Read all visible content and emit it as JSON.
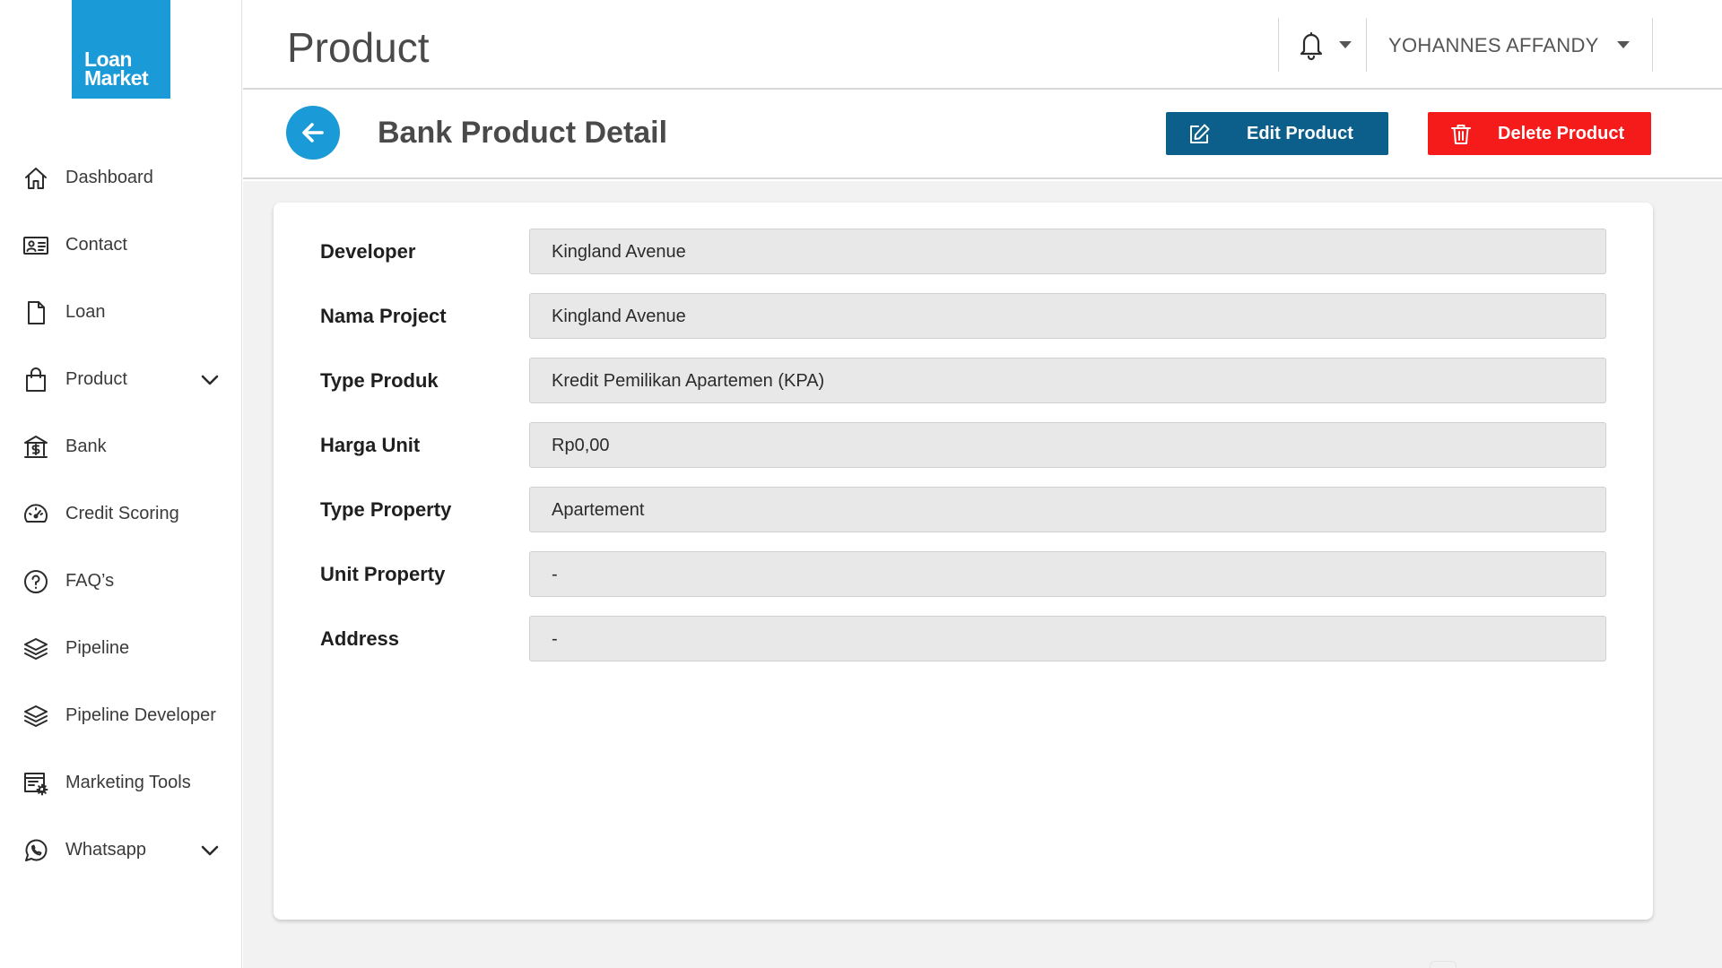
{
  "brand": {
    "logo_line1": "Loan",
    "logo_line2": "Market",
    "color": "#1a9ad6"
  },
  "sidebar": {
    "items": [
      {
        "label": "Dashboard",
        "icon": "home-icon"
      },
      {
        "label": "Contact",
        "icon": "contact-card-icon"
      },
      {
        "label": "Loan",
        "icon": "document-icon"
      },
      {
        "label": "Product",
        "icon": "shopping-bag-icon",
        "expandable": true
      },
      {
        "label": "Bank",
        "icon": "bank-icon"
      },
      {
        "label": "Credit Scoring",
        "icon": "gauge-icon"
      },
      {
        "label": "FAQ’s",
        "icon": "help-circle-icon"
      },
      {
        "label": "Pipeline",
        "icon": "layers-icon"
      },
      {
        "label": "Pipeline Developer",
        "icon": "layers-icon"
      },
      {
        "label": "Marketing Tools",
        "icon": "marketing-settings-icon"
      },
      {
        "label": "Whatsapp",
        "icon": "whatsapp-icon",
        "expandable": true
      }
    ]
  },
  "header": {
    "title": "Product",
    "notification_icon": "bell-icon",
    "user_name": "YOHANNES AFFANDY"
  },
  "subheader": {
    "title": "Bank Product Detail",
    "back_icon": "arrow-left-icon",
    "edit_label": "Edit Product",
    "delete_label": "Delete Product",
    "edit_color": "#0b5f8a",
    "delete_color": "#f51b1b"
  },
  "details": {
    "fields": [
      {
        "label": "Developer",
        "value": "Kingland Avenue"
      },
      {
        "label": "Nama Project",
        "value": "Kingland Avenue"
      },
      {
        "label": "Type Produk",
        "value": "Kredit Pemilikan Apartemen (KPA)"
      },
      {
        "label": "Harga Unit",
        "value": "Rp0,00"
      },
      {
        "label": "Type Property",
        "value": "Apartement"
      },
      {
        "label": "Unit Property",
        "value": "-"
      },
      {
        "label": "Address",
        "value": "-"
      }
    ]
  }
}
